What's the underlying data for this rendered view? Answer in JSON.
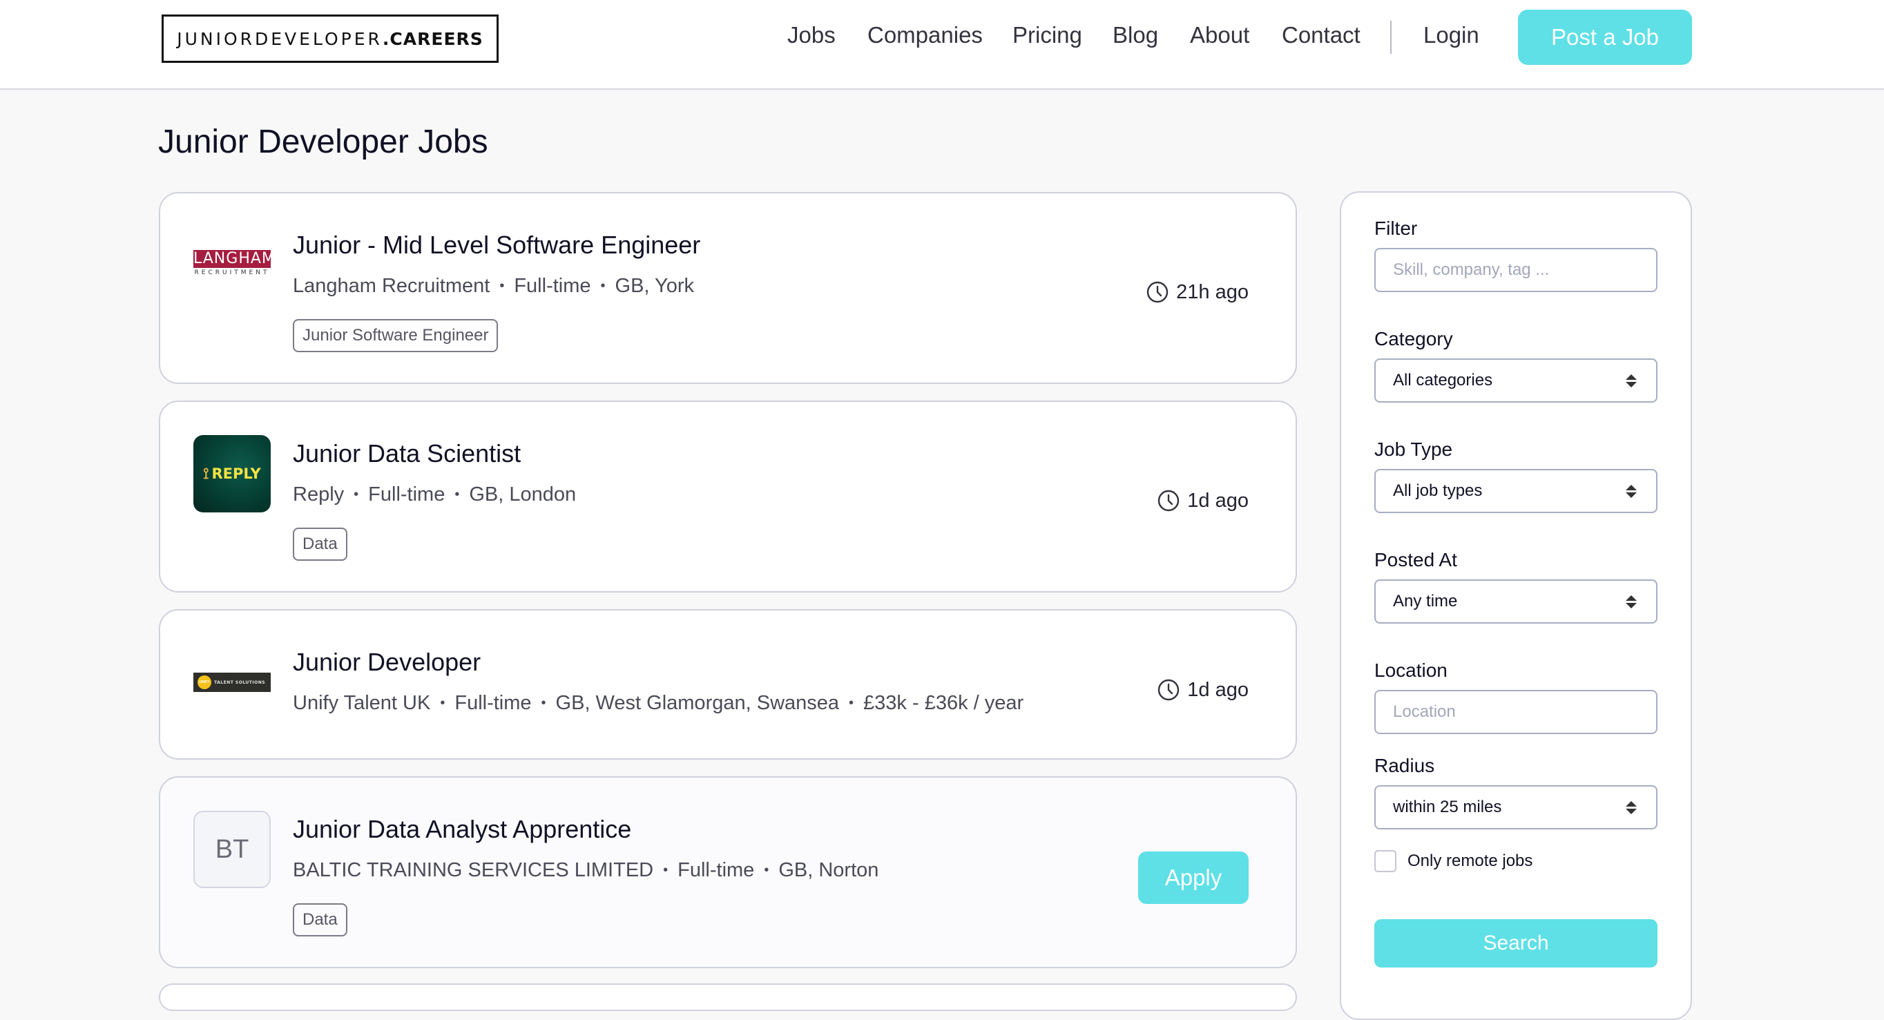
{
  "header": {
    "logo_light": "JUNIORDEVELOPER",
    "logo_bold": ".CAREERS",
    "nav": [
      {
        "label": "Jobs"
      },
      {
        "label": "Companies"
      },
      {
        "label": "Pricing"
      },
      {
        "label": "Blog"
      },
      {
        "label": "About"
      },
      {
        "label": "Contact"
      }
    ],
    "login_label": "Login",
    "post_job_label": "Post a Job"
  },
  "page": {
    "title": "Junior Developer Jobs"
  },
  "jobs": [
    {
      "title": "Junior - Mid Level Software Engineer",
      "company": "Langham Recruitment",
      "logo_text": "LANGHAM",
      "logo_subtext": "RECRUITMENT",
      "type": "Full-time",
      "location": "GB, York",
      "tag": "Junior Software Engineer",
      "posted": "21h ago"
    },
    {
      "title": "Junior Data Scientist",
      "company": "Reply",
      "logo_text": "REPLY",
      "type": "Full-time",
      "location": "GB, London",
      "tag": "Data",
      "posted": "1d ago"
    },
    {
      "title": "Junior Developer",
      "company": "Unify Talent UK",
      "logo_text": "TALENT SOLUTIONS",
      "logo_circle_text": "UNIFY",
      "type": "Full-time",
      "location": "GB, West Glamorgan, Swansea",
      "salary": "£33k - £36k / year",
      "posted": "1d ago"
    },
    {
      "title": "Junior Data Analyst Apprentice",
      "company": "BALTIC TRAINING SERVICES LIMITED",
      "logo_initials": "BT",
      "type": "Full-time",
      "location": "GB, Norton",
      "tag": "Data",
      "apply_label": "Apply"
    }
  ],
  "meta_separator": "•",
  "sidebar": {
    "filter_label": "Filter",
    "filter_placeholder": "Skill, company, tag ...",
    "category_label": "Category",
    "category_value": "All categories",
    "job_type_label": "Job Type",
    "job_type_value": "All job types",
    "posted_at_label": "Posted At",
    "posted_at_value": "Any time",
    "location_label": "Location",
    "location_placeholder": "Location",
    "radius_label": "Radius",
    "radius_value": "within 25 miles",
    "remote_label": "Only remote jobs",
    "remote_checked": false,
    "search_label": "Search"
  },
  "colors": {
    "accent": "#5ee0e6",
    "langham_brand": "#a61d3f",
    "reply_brand": "#053b30",
    "page_bg": "#f7f8f7",
    "card_border": "#cfd1de"
  }
}
